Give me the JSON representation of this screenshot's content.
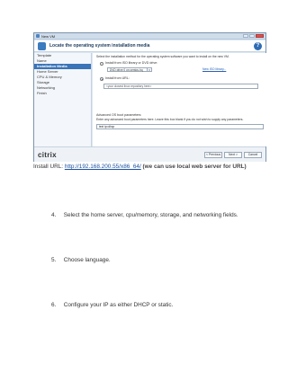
{
  "dialog": {
    "window_title": "New VM",
    "header_title": "Locate the operating system installation media",
    "help_glyph": "?",
    "nav_items": [
      {
        "label": "Template",
        "active": false
      },
      {
        "label": "Name",
        "active": false
      },
      {
        "label": "Installation Media",
        "active": true
      },
      {
        "label": "Home Server",
        "active": false
      },
      {
        "label": "CPU & Memory",
        "active": false
      },
      {
        "label": "Storage",
        "active": false
      },
      {
        "label": "Networking",
        "active": false
      },
      {
        "label": "Finish",
        "active": false
      }
    ],
    "instruction": "Select the installation method for the operating system software you want to install on the new VM.",
    "option_iso": "Install from ISO library or DVD drive:",
    "iso_selected": "DVD drive 0 on centos-hq",
    "new_iso_link": "New ISO library...",
    "option_url": "Install from URL:",
    "url_placeholder": "<your closest linux repository here>",
    "advanced_title": "Advanced OS boot parameters:",
    "advanced_desc": "Enter any advanced boot parameters here. Leave this box blank if you do not wish to supply any parameters.",
    "advanced_value": "text ip=dhcp",
    "brand": "citrix",
    "buttons": {
      "previous": "< Previous",
      "next": "Next >",
      "cancel": "Cancel"
    }
  },
  "doc": {
    "install_label": "Install URL:",
    "install_url": "http://192.168.200.55/x86_64/",
    "install_note": "(we can use local web server for URL)",
    "steps": [
      {
        "num": "4.",
        "text": "Select the home server, cpu/memory, storage, and networking fields."
      },
      {
        "num": "5.",
        "text": "Choose language."
      },
      {
        "num": "6.",
        "text": "Configure your IP as either DHCP or static."
      }
    ]
  }
}
